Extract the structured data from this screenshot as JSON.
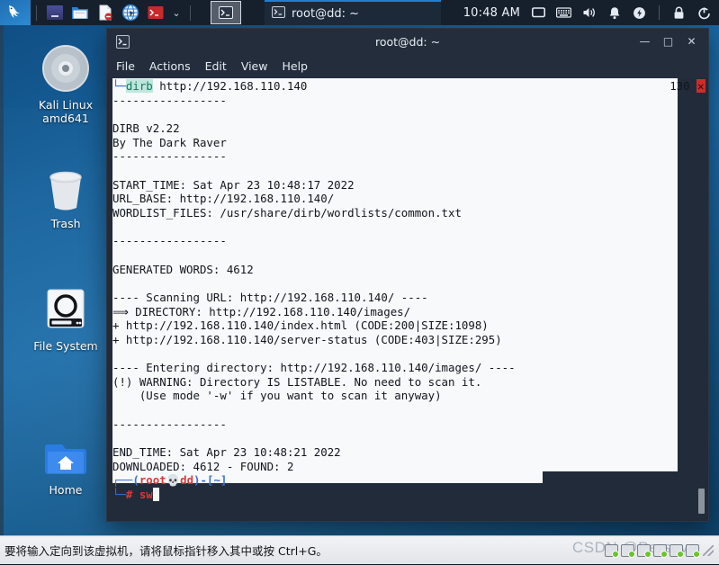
{
  "panel": {
    "logo_name": "kali-dragon-logo",
    "launchers": [
      {
        "name": "app-grid-icon",
        "label": "Applications"
      },
      {
        "name": "file-manager-icon",
        "label": "File Manager"
      },
      {
        "name": "text-editor-icon",
        "label": "Text Editor"
      },
      {
        "name": "web-browser-icon",
        "label": "Web Browser"
      },
      {
        "name": "terminal-icon",
        "label": "Terminal"
      }
    ],
    "chevron": "⌄",
    "active_task_icon": "terminal-icon",
    "window_button": {
      "title": "root@dd: ~",
      "icon": "terminal-icon"
    },
    "clock": "10:48 AM",
    "tray": [
      {
        "name": "display-icon"
      },
      {
        "name": "keyboard-icon"
      },
      {
        "name": "volume-icon"
      },
      {
        "name": "notification-bell-icon"
      },
      {
        "name": "power-icon"
      },
      {
        "name": "lock-icon"
      },
      {
        "name": "logout-icon"
      }
    ]
  },
  "desktop": {
    "icons": [
      {
        "name": "desktop-icon-kali-live",
        "label": "Kali Linux\namd641",
        "label_line1": "Kali Linux",
        "label_line2": "amd641",
        "glyph": "disc-icon"
      },
      {
        "name": "desktop-icon-trash",
        "label": "Trash",
        "glyph": "trash-icon"
      },
      {
        "name": "desktop-icon-file-system",
        "label": "File System",
        "glyph": "drive-icon"
      },
      {
        "name": "desktop-icon-home",
        "label": "Home",
        "glyph": "home-folder-icon"
      }
    ]
  },
  "window": {
    "title": "root@dd: ~",
    "icon": "terminal-icon",
    "menu": [
      "File",
      "Actions",
      "Edit",
      "View",
      "Help"
    ],
    "controls": {
      "minimize": "—",
      "maximize": "□",
      "close": "✕"
    }
  },
  "terminal": {
    "command_prompt_glyph": "└─",
    "command": "dirb",
    "command_arg": " http://192.168.110.140",
    "exit_code": "130",
    "exit_marker": "✕",
    "output": "\n-----------------\n\nDIRB v2.22\nBy The Dark Raver\n-----------------\n\nSTART_TIME: Sat Apr 23 10:48:17 2022\nURL_BASE: http://192.168.110.140/\nWORDLIST_FILES: /usr/share/dirb/wordlists/common.txt\n\n-----------------\n\nGENERATED WORDS: 4612\n\n---- Scanning URL: http://192.168.110.140/ ----\n⟹ DIRECTORY: http://192.168.110.140/images/\n+ http://192.168.110.140/index.html (CODE:200|SIZE:1098)\n+ http://192.168.110.140/server-status (CODE:403|SIZE:295)\n\n---- Entering directory: http://192.168.110.140/images/ ----\n(!) WARNING: Directory IS LISTABLE. No need to scan it.\n    (Use mode '-w' if you want to scan it anyway)\n\n-----------------\n\nEND_TIME: Sat Apr 23 10:48:21 2022\nDOWNLOADED: 4612 - FOUND: 2\n",
    "prompt": {
      "line1_box": "┌──(",
      "user": "root",
      "skull": "💀",
      "host": "dd",
      "line1_close": ")-[",
      "path": "~",
      "line1_end": "]",
      "line2_box": "└─",
      "hash": "#",
      "input": " sw"
    }
  },
  "statusbar": {
    "message": "要将输入定向到该虚拟机，请将鼠标指针移入其中或按 Ctrl+G。",
    "watermark": "CSDN @Perseve"
  },
  "colors": {
    "panel_bg": "#16202d",
    "desktop_blue": "#17629c",
    "terminal_bg": "#222b39",
    "selection_bg": "#f7f9fa",
    "prompt_red": "#d93a36",
    "prompt_blue": "#3b6fd4",
    "accent_blue": "#1f7fd4",
    "error_red": "#cf2b2b"
  }
}
